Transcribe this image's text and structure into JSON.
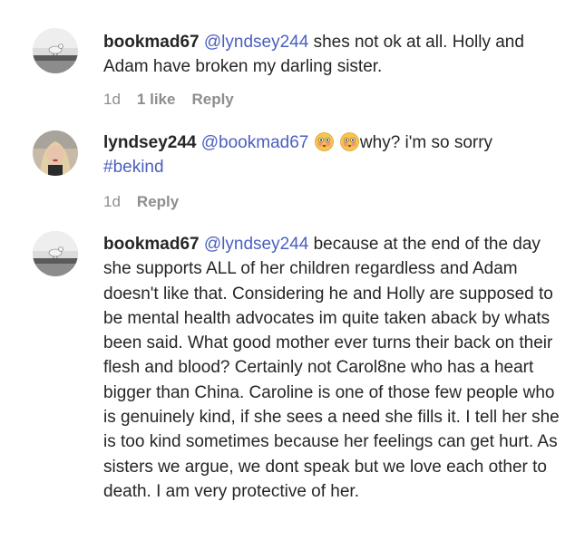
{
  "comments": [
    {
      "username": "bookmad67",
      "mention": "@lyndsey244",
      "text": "shes not ok at all. Holly and Adam have broken my darling sister.",
      "time": "1d",
      "likes": "1 like",
      "reply": "Reply"
    },
    {
      "username": "lyndsey244",
      "mention": "@bookmad67",
      "emoji_icons": [
        "flushed-face-icon",
        "flushed-face-icon"
      ],
      "text": "why? i'm so sorry",
      "hashtag": "#bekind",
      "time": "1d",
      "reply": "Reply"
    },
    {
      "username": "bookmad67",
      "mention": "@lyndsey244",
      "text": "because at the end of the day she supports ALL of her children regardless and Adam doesn't like that. Considering he and Holly are supposed to be mental health advocates im quite taken aback by whats been said. What good mother ever turns their back on their flesh and blood? Certainly not Carol8ne who has a heart bigger than China. Caroline is one of those few people who is genuinely kind, if she sees a need she fills it. I tell her she is too kind sometimes because her feelings can get hurt. As sisters we argue, we dont speak but we love each other to death. I am very protective of her."
    }
  ],
  "colors": {
    "text": "#262626",
    "link": "#4a5fc1",
    "muted": "#8e8e8e"
  }
}
